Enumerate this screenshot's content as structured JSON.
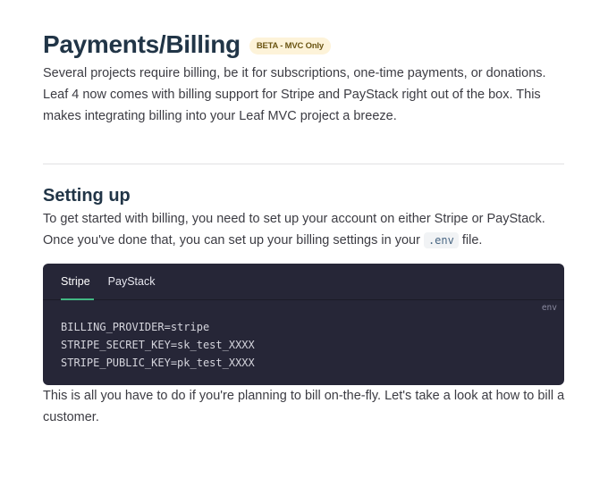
{
  "header": {
    "title": "Payments/Billing",
    "badge": "BETA - MVC Only"
  },
  "intro": {
    "text": "Several projects require billing, be it for subscriptions, one-time payments, or donations. Leaf 4 now comes with billing support for Stripe and PayStack right out of the box. This makes integrating billing into your Leaf MVC project a breeze."
  },
  "setup": {
    "heading": "Setting up",
    "text_before": "To get started with billing, you need to set up your account on either Stripe or PayStack. Once you've done that, you can set up your billing settings in your ",
    "inline_code": ".env",
    "text_after": " file."
  },
  "code_block": {
    "tabs": [
      {
        "label": "Stripe",
        "active": true
      },
      {
        "label": "PayStack",
        "active": false
      }
    ],
    "language": "env",
    "lines": [
      "BILLING_PROVIDER=stripe",
      "STRIPE_SECRET_KEY=sk_test_XXXX",
      "STRIPE_PUBLIC_KEY=pk_test_XXXX"
    ]
  },
  "outro": {
    "text": "This is all you have to do if you're planning to bill on-the-fly. Let's take a look at how to bill a customer."
  },
  "colors": {
    "accent": "#42b883",
    "code_bg": "#262637",
    "badge_bg": "#fdf3d9"
  }
}
